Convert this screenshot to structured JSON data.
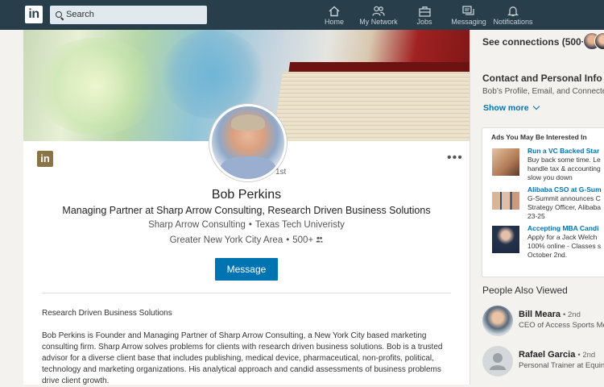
{
  "nav": {
    "logo": "in",
    "search_placeholder": "Search",
    "items": [
      {
        "label": "Home",
        "icon": "home-icon"
      },
      {
        "label": "My Network",
        "icon": "network-icon"
      },
      {
        "label": "Jobs",
        "icon": "briefcase-icon"
      },
      {
        "label": "Messaging",
        "icon": "messaging-icon"
      },
      {
        "label": "Notifications",
        "icon": "bell-icon"
      }
    ]
  },
  "profile": {
    "badge": "in",
    "more": "•••",
    "degree": "1st",
    "name": "Bob Perkins",
    "headline": "Managing Partner at Sharp Arrow Consulting, Research Driven Business Solutions",
    "company": "Sharp Arrow Consulting",
    "school": "Texas Tech Univeristy",
    "location": "Greater New York City Area",
    "connections": "500+",
    "message_label": "Message",
    "summary_title": "Research Driven Business Solutions",
    "summary_text": "Bob Perkins is Founder and Managing Partner of Sharp Arrow Consulting, a New York City based marketing consulting firm. Sharp Arrow solves problems for clients with research driven business solutions. Bob is a trusted advisor for a diverse client base that includes publishing, medical device, pharmaceutical, non-profits, political, technology and marketing organizations. His analytical approach and candid assessments of business problems drive client growth."
  },
  "rail": {
    "see_connections": "See connections (500+)",
    "contact_title": "Contact and Personal Info",
    "contact_sub": "Bob’s Profile, Email, and Connecte",
    "show_more": "Show more",
    "ads_title": "Ads You May Be Interested In",
    "ads": [
      {
        "title": "Run a VC Backed Star",
        "text": "Buy back some time. Le\nhandle tax & accounting\nslow you down"
      },
      {
        "title": "Alibaba CSO at G-Sum",
        "text": "G-Summit announces C\nStrategy Officer, Alibaba\n23-25"
      },
      {
        "title": "Accepting MBA Candi",
        "text": "Apply for a Jack Welch\n100% online - Classes s\nOctober 2nd."
      }
    ],
    "people_title": "People Also Viewed",
    "people": [
      {
        "name": "Bill Meara",
        "degree": "2nd",
        "title": "CEO of Access Sports Med"
      },
      {
        "name": "Rafael Garcia",
        "degree": "2nd",
        "title": "Personal Trainer at Equin"
      }
    ]
  }
}
